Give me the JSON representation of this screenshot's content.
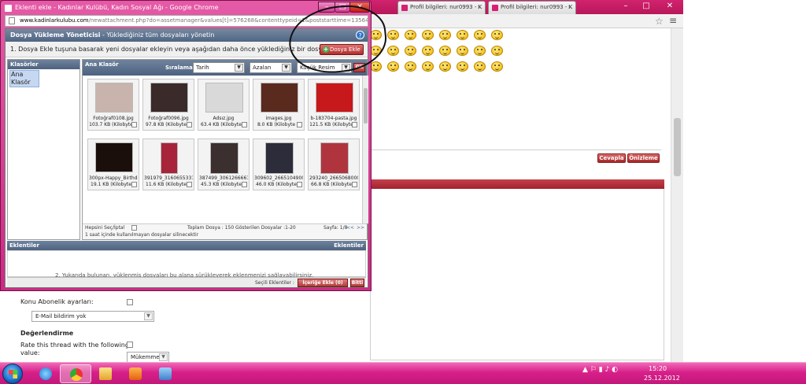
{
  "background_browser": {
    "tabs": [
      {
        "label": "Profil bilgileri: nur0993 - K"
      },
      {
        "label": "Profil bilgileri: nur0993 - K"
      }
    ],
    "window_controls": {
      "minimize": "–",
      "maximize": "□",
      "close": "✕"
    },
    "reply_button": "Cevapla",
    "preview_button": "Önizleme",
    "options": {
      "subscription_label": "Konu Abonelik ayarları:",
      "subscription_select": "E-Mail bildirim yok",
      "rating_heading": "Değerlendirme",
      "rating_label_line1": "Rate this thread with the following",
      "rating_label_line2": "value:",
      "rating_select": "Mükemmel"
    }
  },
  "popup": {
    "title": "Eklenti ekle - Kadınlar Kulübü, Kadın Sosyal Ağı - Google Chrome",
    "url_host": "www.kadinlarkulubu.com",
    "url_path": "/newattachment.php?do=assetmanager&values[t]=576268&contenttypeid=1&poststarttime=1356441683",
    "manager_title": "Dosya Yükleme Yöneticisi",
    "manager_subtitle": " - Yüklediğiniz tüm dosyaları yönetin",
    "help": "?",
    "instruction": "1. Dosya Ekle tuşuna basarak yeni dosyalar ekleyin veya aşağıdan daha önce yüklediğiniz bir dosyayı seçin",
    "add_file_button": "Dosya Ekle",
    "folders_heading": "Klasörler",
    "root_folder": "Ana Klasör",
    "gallery_heading": "Ana Klasör",
    "sort_label": "Sıralama:",
    "sort_field": "Tarih",
    "sort_order": "Azalan",
    "view_mode": "Küçük Resim",
    "go_button": "Git",
    "files": [
      {
        "name": "Fotoğraf0108.jpg",
        "size": "103.7 KB (Kilobyte",
        "color": "#c9b3ad"
      },
      {
        "name": "Fotoğraf0096.jpg",
        "size": "97.8 KB (Kilobyte",
        "color": "#3a2a2a"
      },
      {
        "name": "Adsız.jpg",
        "size": "63.4 KB (Kilobyte",
        "color": "#d9d9d9"
      },
      {
        "name": "images.jpg",
        "size": "8.0 KB (Kilobyte",
        "color": "#5a2a1f"
      },
      {
        "name": "b-183704-pasta.jpg",
        "size": "121.5 KB (Kilobyte",
        "color": "#c7181c"
      },
      {
        "name": "300px-Happy_Birthda",
        "size": "19.1 KB (Kilobyte",
        "color": "#1a0f0a"
      },
      {
        "name": "391979_316065533171",
        "size": "11.6 KB (Kilobyte",
        "color": "#a8243a"
      },
      {
        "name": "387499_306126666149",
        "size": "45.3 KB (Kilobyte",
        "color": "#3b2f2f"
      },
      {
        "name": "309602_266510490035",
        "size": "46.0 KB (Kilobyte",
        "color": "#2c2c3a"
      },
      {
        "name": "293240_266506800035",
        "size": "66.8 KB (Kilobyte",
        "color": "#b0343e"
      }
    ],
    "select_all": "Hepsini Seç/İptal",
    "total_files": "Toplam Dosya : 150 Gösterilen Dosyalar :1-20",
    "page_info": "Sayfa: 1/8",
    "prev_page": "<<",
    "next_page": ">>",
    "delete_notice": "1 saat içinde kullanılmayan dosyalar silinecektir",
    "attachments_heading": "Eklentiler",
    "attachments_heading_right": "Eklentiler",
    "drop_message": "2. Yukarıda bulunan, yüklenmiş dosyaları bu alana sürükleyerek eklenmenizi sağlayabilirsiniz.",
    "selected_label": "Seçili Eklentiler :",
    "insert_button": "İçeriğe Ekle (0)",
    "done_button": "Bitti"
  },
  "taskbar": {
    "time": "15:20",
    "date": "25.12.2012",
    "tray_icons": "▲ ⚐ ▮ ♪ ◐"
  },
  "colors": {
    "theme_pink": "#d81f8a",
    "accent_red": "#b12d2d",
    "header_slate": "#4f6582"
  }
}
